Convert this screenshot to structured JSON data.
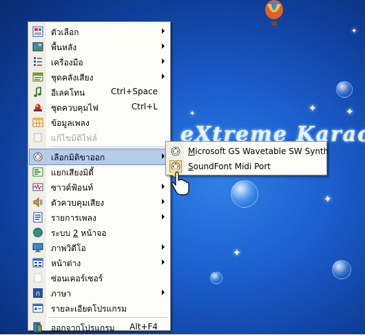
{
  "menu": {
    "items": [
      {
        "label": "ตัวเลือก",
        "icon": "options-icon",
        "submenu": true
      },
      {
        "label": "พื้นหลัง",
        "icon": "wallpaper-icon",
        "submenu": true
      },
      {
        "label": "เครื่องมือ",
        "icon": "tools-icon",
        "submenu": true
      },
      {
        "label": "ชุดคลังเสียง",
        "icon": "sound-library-icon",
        "submenu": true
      },
      {
        "label": "อีเลคโทน",
        "icon": "music-note-icon",
        "shortcut": "Ctrl+Space"
      },
      {
        "label": "ชุดควบคุมไฟ",
        "icon": "siren-light-icon",
        "shortcut": "Ctrl+L"
      },
      {
        "label": "ข้อมูลเพลง",
        "icon": "song-data-grid-icon"
      },
      {
        "label": "แก้ไขมิดิไฟล์",
        "icon": "edit-midi-icon",
        "disabled": true
      },
      {
        "label": "เลือกมิดิขาออก",
        "icon": "midi-port-icon",
        "submenu": true,
        "highlighted": true
      },
      {
        "label": "แยกเสียงมิดี้",
        "icon": "midi-split-icon"
      },
      {
        "label": "ซาวด์ฟ้อนท์",
        "icon": "soundfont-icon",
        "submenu": true
      },
      {
        "label": "ตัวควบคุมเสียง",
        "icon": "speaker-icon",
        "submenu": true
      },
      {
        "label": "รายการเพลง",
        "icon": "playlist-icon",
        "submenu": true
      },
      {
        "label_pre": "ระบบ ",
        "label_ul": "2",
        "label_post": " หน้าจอ",
        "icon": "dual-monitor-icon"
      },
      {
        "label": "ภาพวิดีโอ",
        "icon": "video-monitor-icon",
        "submenu": true
      },
      {
        "label": "หน้าต่าง",
        "icon": "window-grid-icon",
        "submenu": true
      },
      {
        "label": "ซ่อนเคอร์เซอร์",
        "icon": "blank-icon"
      },
      {
        "label": "ภาษา",
        "icon": "language-icon",
        "submenu": true
      },
      {
        "label": "รายละเอียดโปรแกรม",
        "icon": "about-icon"
      },
      {
        "label": "ออกจากโปรแกรม",
        "icon": "exit-door-icon",
        "shortcut": "Alt+F4"
      }
    ]
  },
  "submenu": {
    "items": [
      {
        "label_ul": "M",
        "label_rest": "icrosoft GS Wavetable SW Synth",
        "icon": "midi-port-icon"
      },
      {
        "label_ul": "S",
        "label_rest": "oundFont Midi Port",
        "icon": "midi-port-icon",
        "active": true
      }
    ]
  },
  "background": {
    "brand": "eXtreme Karao",
    "colors": {
      "sky_light": "#2f7fe6",
      "sky_dark": "#082a6e"
    }
  },
  "colors": {
    "menu_bg": "#fcfcf9",
    "gutter": "#f0efe6",
    "highlight": "#b6ccea",
    "highlight_border": "#6b8fc9",
    "disabled_text": "#a7a7a7"
  }
}
